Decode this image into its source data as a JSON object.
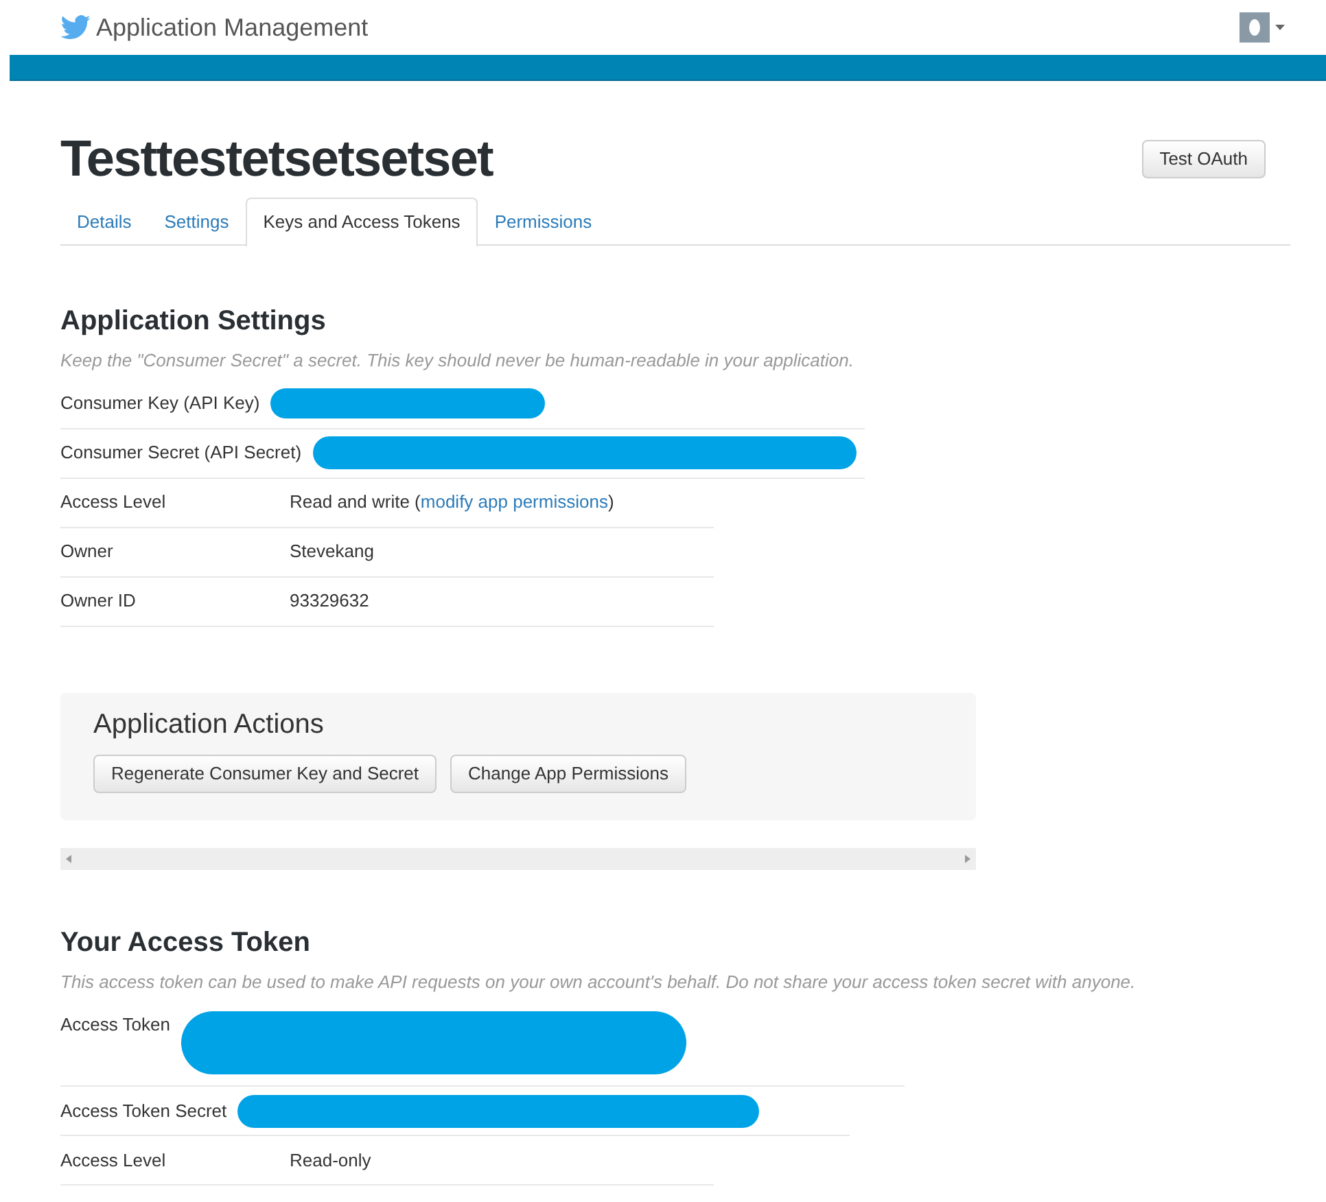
{
  "header": {
    "title": "Application Management"
  },
  "app": {
    "name": "Testtestetsetsetset",
    "test_button": "Test OAuth"
  },
  "tabs": [
    {
      "label": "Details",
      "selected": false
    },
    {
      "label": "Settings",
      "selected": false
    },
    {
      "label": "Keys and Access Tokens",
      "selected": true
    },
    {
      "label": "Permissions",
      "selected": false
    }
  ],
  "application_settings": {
    "title": "Application Settings",
    "note": "Keep the \"Consumer Secret\" a secret. This key should never be human-readable in your application.",
    "rows": [
      {
        "label": "Consumer Key (API Key)",
        "kind": "redacted"
      },
      {
        "label": "Consumer Secret (API Secret)",
        "kind": "redacted"
      },
      {
        "label": "Access Level",
        "kind": "link",
        "prefix": "Read and write (",
        "link": "modify app permissions",
        "suffix": ")"
      },
      {
        "label": "Owner",
        "kind": "text",
        "value": "Stevekang"
      },
      {
        "label": "Owner ID",
        "kind": "text",
        "value": "93329632"
      }
    ]
  },
  "application_actions": {
    "title": "Application Actions",
    "buttons": [
      "Regenerate Consumer Key and Secret",
      "Change App Permissions"
    ]
  },
  "access_token": {
    "title": "Your Access Token",
    "note": "This access token can be used to make API requests on your own account's behalf. Do not share your access token secret with anyone.",
    "rows": [
      {
        "label": "Access Token",
        "kind": "redacted"
      },
      {
        "label": "Access Token Secret",
        "kind": "redacted"
      },
      {
        "label": "Access Level",
        "kind": "text",
        "value": "Read-only"
      }
    ]
  }
}
